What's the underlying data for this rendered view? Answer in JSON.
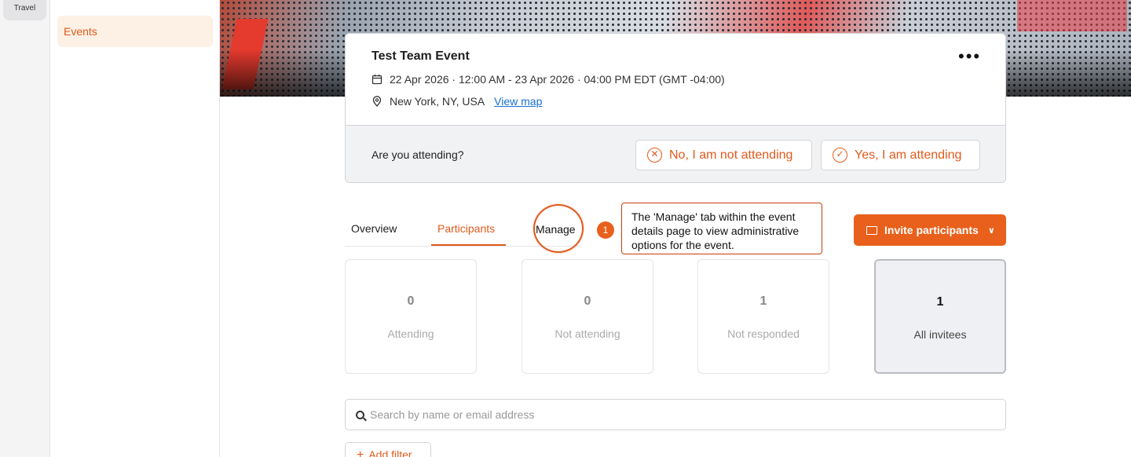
{
  "rail": {
    "travel_label": "Travel"
  },
  "subnav": {
    "events_label": "Events"
  },
  "event": {
    "title": "Test Team Event",
    "date_range": "22 Apr 2026 · 12:00 AM - 23 Apr 2026 · 04:00 PM EDT (GMT -04:00)",
    "location": "New York, NY, USA",
    "view_map_label": "View map",
    "more_label": "•••"
  },
  "attendance": {
    "question": "Are you attending?",
    "no_label": "No, I am not attending",
    "yes_label": "Yes, I am attending"
  },
  "tabs": {
    "overview": "Overview",
    "participants": "Participants",
    "manage": "Manage"
  },
  "annotation": {
    "step": "1",
    "text": "The 'Manage' tab within the event details page to view administrative options for the event."
  },
  "invite_button": {
    "label": "Invite participants"
  },
  "stats": [
    {
      "value": "0",
      "label": "Attending"
    },
    {
      "value": "0",
      "label": "Not attending"
    },
    {
      "value": "1",
      "label": "Not responded"
    },
    {
      "value": "1",
      "label": "All invitees"
    }
  ],
  "search": {
    "placeholder": "Search by name or email address",
    "value": ""
  },
  "filter": {
    "add_label": "Add filter"
  },
  "colors": {
    "accent": "#e8601c",
    "link": "#1a6fd1"
  }
}
